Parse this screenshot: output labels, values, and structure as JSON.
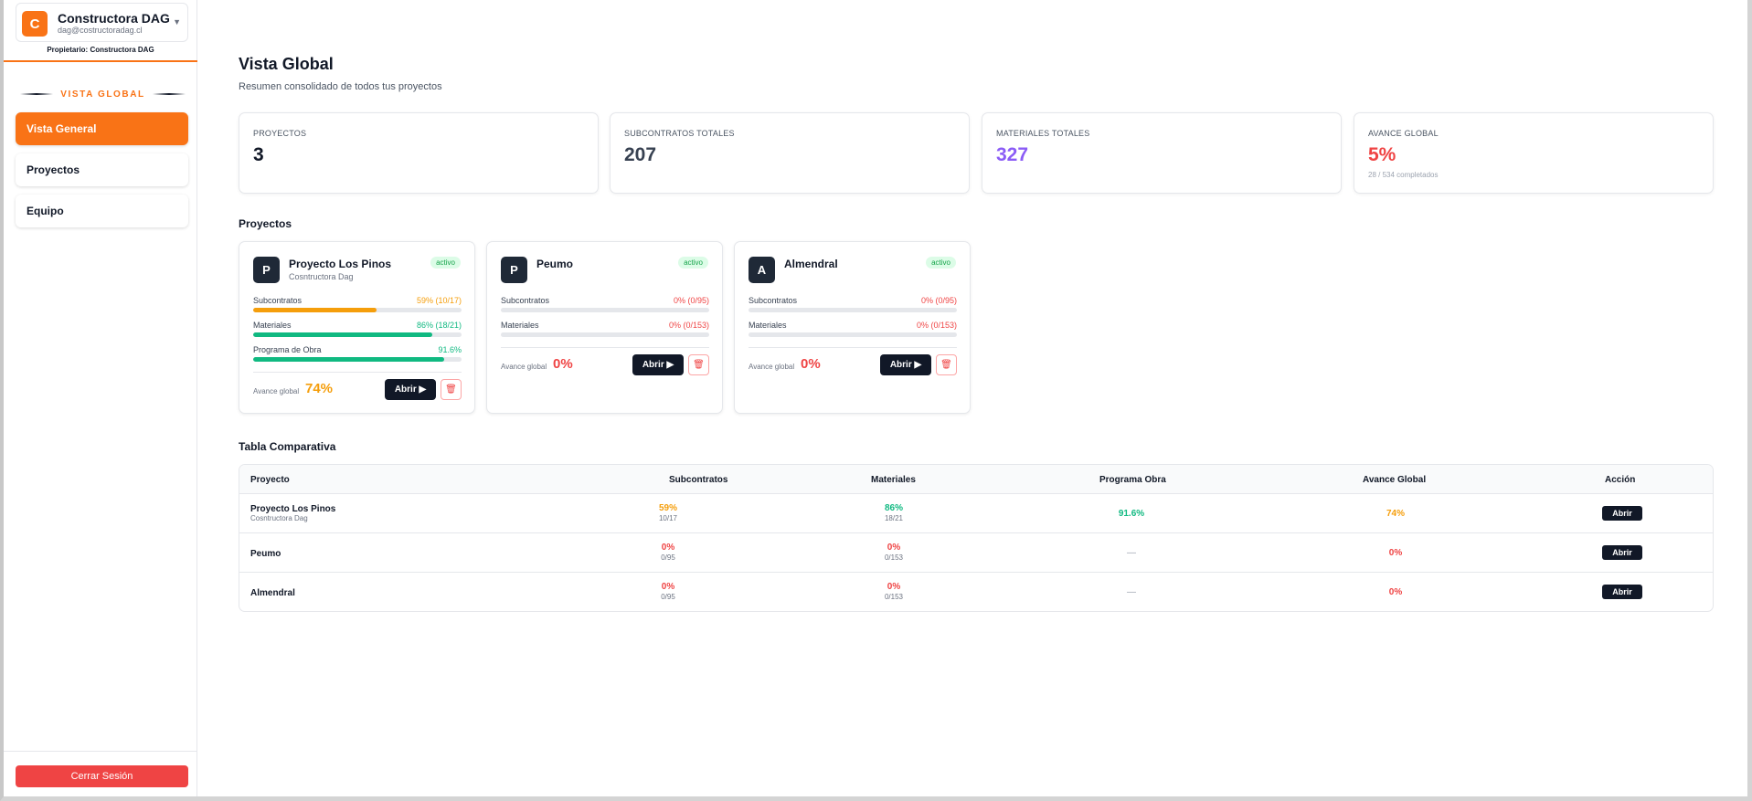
{
  "colors": {
    "accent": "#f97316",
    "orange": "#f59e0b",
    "green": "#10b981",
    "red": "#ef4444",
    "purple": "#8b5cf6",
    "dark": "#111827"
  },
  "company": {
    "initial": "C",
    "name": "Constructora DAG",
    "email": "dag@costructoradag.cl",
    "owner": "Propietario: Constructora DAG",
    "chevron": "▼"
  },
  "sidebar": {
    "section_title": "VISTA GLOBAL",
    "items": [
      {
        "label": "Vista General",
        "active": true
      },
      {
        "label": "Proyectos",
        "active": false
      },
      {
        "label": "Equipo",
        "active": false
      }
    ],
    "logout": "Cerrar Sesión"
  },
  "header": {
    "title": "Vista Global",
    "subtitle": "Resumen consolidado de todos tus proyectos"
  },
  "stats": [
    {
      "label": "PROYECTOS",
      "value": "3",
      "color": "#111827"
    },
    {
      "label": "SUBCONTRATOS TOTALES",
      "value": "207",
      "color": "#374151"
    },
    {
      "label": "MATERIALES TOTALES",
      "value": "327",
      "color": "#8b5cf6"
    },
    {
      "label": "AVANCE GLOBAL",
      "value": "5%",
      "color": "#ef4444",
      "sub": "28 / 534 completados"
    }
  ],
  "projects_title": "Proyectos",
  "projects": [
    {
      "initial": "P",
      "name": "Proyecto Los Pinos",
      "company": "Cosntructora Dag",
      "status": "activo",
      "sub_label": "Subcontratos",
      "sub_value": "59% (10/17)",
      "sub_pct": 59,
      "mat_label": "Materiales",
      "mat_value": "86% (18/21)",
      "mat_pct": 86,
      "prog_label": "Programa de Obra",
      "prog_value": "91.6%",
      "prog_pct": 91.6,
      "avance_label": "Avance global",
      "avance": "74%",
      "open": "Abrir ▶",
      "delete_icon": "🗑"
    },
    {
      "initial": "P",
      "name": "Peumo",
      "company": "",
      "status": "activo",
      "sub_label": "Subcontratos",
      "sub_value": "0% (0/95)",
      "sub_pct": 0,
      "mat_label": "Materiales",
      "mat_value": "0% (0/153)",
      "mat_pct": 0,
      "avance_label": "Avance global",
      "avance": "0%",
      "open": "Abrir ▶",
      "delete_icon": "🗑"
    },
    {
      "initial": "A",
      "name": "Almendral",
      "company": "",
      "status": "activo",
      "sub_label": "Subcontratos",
      "sub_value": "0% (0/95)",
      "sub_pct": 0,
      "mat_label": "Materiales",
      "mat_value": "0% (0/153)",
      "mat_pct": 0,
      "avance_label": "Avance global",
      "avance": "0%",
      "open": "Abrir ▶",
      "delete_icon": "🗑"
    }
  ],
  "table_title": "Tabla Comparativa",
  "table": {
    "headers": [
      "Proyecto",
      "Subcontratos",
      "Materiales",
      "Programa Obra",
      "Avance Global",
      "Acción"
    ],
    "rows": [
      {
        "name": "Proyecto Los Pinos",
        "company": "Cosntructora Dag",
        "sub_pct": "59%",
        "sub_frac": "10/17",
        "mat_pct": "86%",
        "mat_frac": "18/21",
        "prog": "91.6%",
        "avance": "74%",
        "action": "Abrir"
      },
      {
        "name": "Peumo",
        "company": "",
        "sub_pct": "0%",
        "sub_frac": "0/95",
        "mat_pct": "0%",
        "mat_frac": "0/153",
        "prog": "—",
        "avance": "0%",
        "action": "Abrir"
      },
      {
        "name": "Almendral",
        "company": "",
        "sub_pct": "0%",
        "sub_frac": "0/95",
        "mat_pct": "0%",
        "mat_frac": "0/153",
        "prog": "—",
        "avance": "0%",
        "action": "Abrir"
      }
    ]
  }
}
